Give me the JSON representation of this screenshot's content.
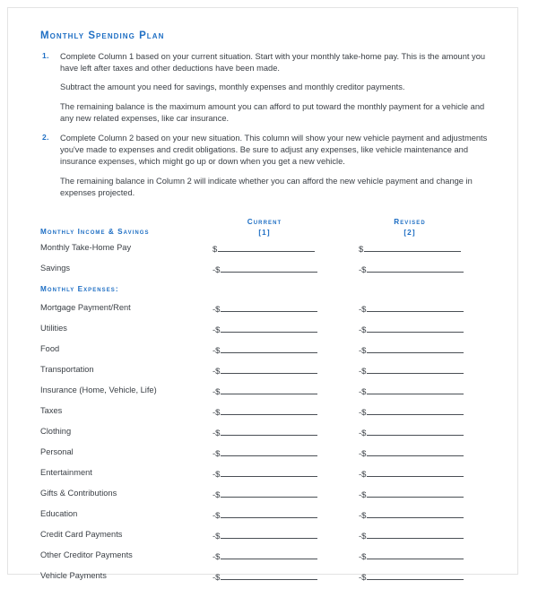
{
  "document": {
    "title": "Monthly Spending Plan"
  },
  "intro": {
    "steps": [
      {
        "number": "1.",
        "paragraphs": [
          "Complete Column 1 based on your current situation. Start with your monthly take-home pay. This is the amount you have left after taxes and other deductions have been made.",
          "Subtract the amount you need for savings, monthly expenses and monthly creditor payments.",
          "The remaining balance is the maximum amount you can afford to put toward the monthly payment for a vehicle and any new related expenses, like car insurance."
        ]
      },
      {
        "number": "2.",
        "paragraphs": [
          "Complete Column 2 based on your new situation. This column will show your new vehicle payment and adjustments you've made to expenses and credit obligations. Be sure to adjust any expenses, like vehicle maintenance and insurance expenses, which might go up or down when you get a new vehicle.",
          "The remaining balance in Column 2 will indicate whether you can afford the new vehicle payment and change in expenses projected."
        ]
      }
    ]
  },
  "table": {
    "section_label": "Monthly Income & Savings",
    "columns": [
      {
        "name": "Current",
        "index": "[1]"
      },
      {
        "name": "Revised",
        "index": "[2]"
      }
    ],
    "expenses_heading": "Monthly Expenses:",
    "rows": [
      {
        "label": "Monthly Take-Home Pay",
        "sign": "$",
        "value_current": "",
        "value_revised": ""
      },
      {
        "label": "Savings",
        "sign": "-$",
        "value_current": "",
        "value_revised": ""
      },
      {
        "label": "Mortgage Payment/Rent",
        "sign": "-$",
        "value_current": "",
        "value_revised": ""
      },
      {
        "label": "Utilities",
        "sign": "-$",
        "value_current": "",
        "value_revised": ""
      },
      {
        "label": "Food",
        "sign": "-$",
        "value_current": "",
        "value_revised": ""
      },
      {
        "label": "Transportation",
        "sign": "-$",
        "value_current": "",
        "value_revised": ""
      },
      {
        "label": "Insurance (Home, Vehicle, Life)",
        "sign": "-$",
        "value_current": "",
        "value_revised": ""
      },
      {
        "label": "Taxes",
        "sign": "-$",
        "value_current": "",
        "value_revised": ""
      },
      {
        "label": "Clothing",
        "sign": "-$",
        "value_current": "",
        "value_revised": ""
      },
      {
        "label": "Personal",
        "sign": "-$",
        "value_current": "",
        "value_revised": ""
      },
      {
        "label": "Entertainment",
        "sign": "-$",
        "value_current": "",
        "value_revised": ""
      },
      {
        "label": "Gifts & Contributions",
        "sign": "-$",
        "value_current": "",
        "value_revised": ""
      },
      {
        "label": "Education",
        "sign": "-$",
        "value_current": "",
        "value_revised": ""
      },
      {
        "label": "Credit Card Payments",
        "sign": "-$",
        "value_current": "",
        "value_revised": ""
      },
      {
        "label": "Other Creditor Payments",
        "sign": "-$",
        "value_current": "",
        "value_revised": ""
      },
      {
        "label": "Vehicle Payments",
        "sign": "-$",
        "value_current": "",
        "value_revised": ""
      }
    ],
    "expenses_heading_after_row_index": 1
  },
  "theme": {
    "accent_blue": "#1F6FC4",
    "body_text": "#3A3F45",
    "rule_color": "#4A4F55",
    "page_border": "#E3E3E3",
    "background": "#FFFFFF"
  }
}
